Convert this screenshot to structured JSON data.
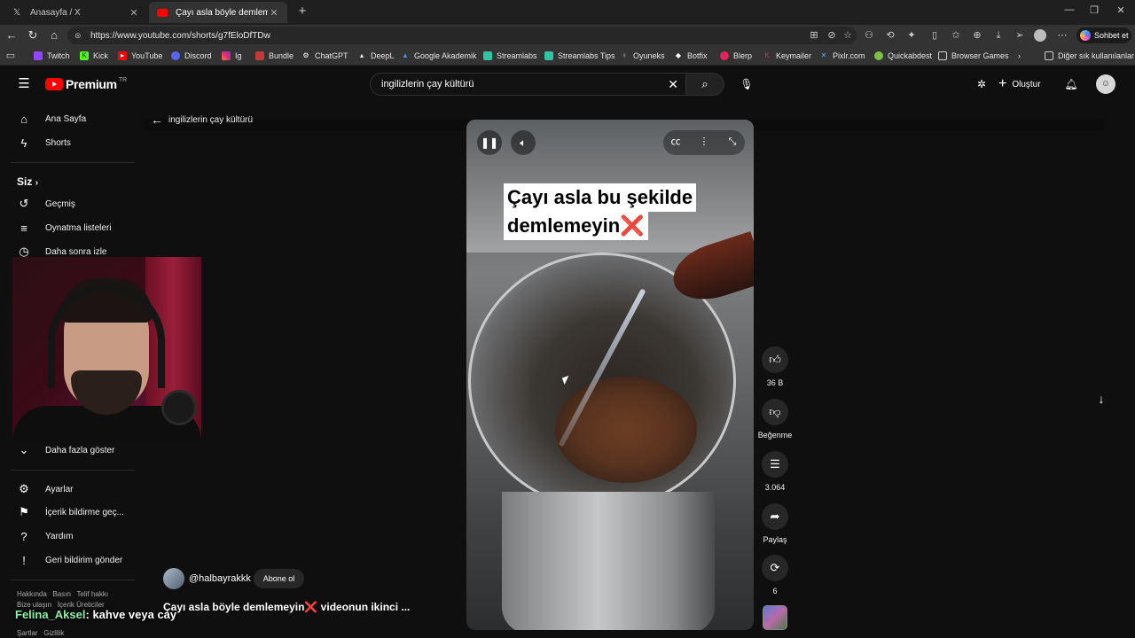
{
  "browser": {
    "tabs": [
      {
        "label": "Anasayfa / X",
        "icon": "x-logo-icon"
      },
      {
        "label": "Çayı asla böyle demlemeyin❌",
        "icon": "youtube-icon",
        "audio": true
      }
    ],
    "url": "https://www.youtube.com/shorts/g7fEloDfTDw",
    "copilot_label": "Sohbet et",
    "bookmarks": [
      "Twitch",
      "Kick",
      "YouTube",
      "Discord",
      "Ig",
      "Bundle",
      "ChatGPT",
      "DeepL",
      "Google Akademik",
      "Streamlabs",
      "Streamlabs Tips",
      "Oyuneks",
      "Botfix",
      "Blerp",
      "Keymailer",
      "Pixlr.com",
      "Quickabdest",
      "Browser Games"
    ],
    "other_bookmarks": "Diğer sık kullanılanlar"
  },
  "masthead": {
    "logo_text": "Premium",
    "logo_region": "TR",
    "search_value": "ingilizlerin çay kültürü",
    "create_label": "Oluştur"
  },
  "sidebar": {
    "main": [
      "Ana Sayfa",
      "Shorts"
    ],
    "you_header": "Siz",
    "you_items": [
      "Geçmiş",
      "Oynatma listeleri",
      "Daha sonra izle"
    ],
    "show_more": "Daha fazla göster",
    "bottom": [
      "Ayarlar",
      "İçerik bildirme geç...",
      "Yardım",
      "Geri bildirim gönder"
    ],
    "footer": [
      "Hakkında",
      "Basın",
      "Telif hakkı",
      "Bize ulaşın",
      "İçerik Üreticiler",
      "Şartlar",
      "Gizlilik"
    ]
  },
  "shorts": {
    "back_label": "ingilizlerin çay kültürü",
    "caption_line1": "Çayı asla bu şekilde",
    "caption_line2": "demlemeyin",
    "caption_cross": "❌",
    "channel": "@halbayrakkk",
    "subscribe_label": "Abone ol",
    "title": "Çayı asla böyle demlemeyin❌ videonun ikinci ...",
    "actions": {
      "like_count": "36 B",
      "dislike_label": "Beğenme",
      "comment_count": "3.064",
      "share_label": "Paylaş",
      "remix_count": "6"
    }
  },
  "stream_overlay": {
    "chat_user": "Felina_Aksel",
    "chat_message": ": kahve veya cay"
  },
  "colors": {
    "background": "#0f0f0f",
    "youtube_red": "#ff0000",
    "caption_cross": "#e32236",
    "chat_user": "#8cf0a4"
  }
}
